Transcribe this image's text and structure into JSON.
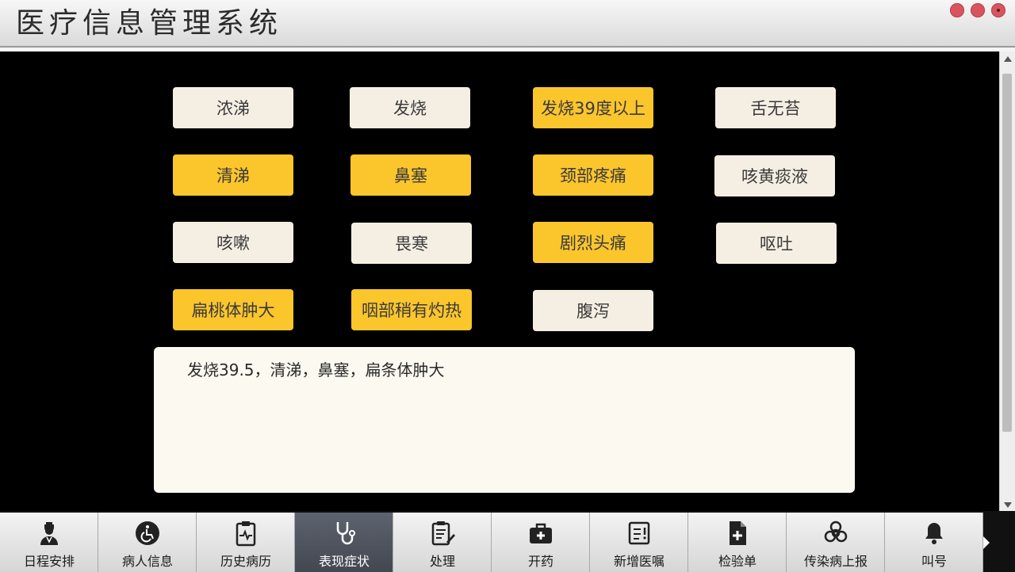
{
  "app": {
    "title": "医疗信息管理系统"
  },
  "symptoms": [
    {
      "label": "浓涕",
      "selected": false
    },
    {
      "label": "发烧",
      "selected": false
    },
    {
      "label": "发烧39度以上",
      "selected": true
    },
    {
      "label": "舌无苔",
      "selected": false
    },
    {
      "label": "清涕",
      "selected": true
    },
    {
      "label": "鼻塞",
      "selected": true
    },
    {
      "label": "颈部疼痛",
      "selected": true
    },
    {
      "label": "咳黄痰液",
      "selected": false
    },
    {
      "label": "咳嗽",
      "selected": false
    },
    {
      "label": "畏寒",
      "selected": false
    },
    {
      "label": "剧烈头痛",
      "selected": true
    },
    {
      "label": "呕吐",
      "selected": false
    },
    {
      "label": "扁桃体肿大",
      "selected": true
    },
    {
      "label": "咽部稍有灼热",
      "selected": true
    },
    {
      "label": "腹泻",
      "selected": false
    }
  ],
  "notes": {
    "text": "发烧39.5，清涕，鼻塞，扁条体肿大"
  },
  "nav": [
    {
      "label": "日程安排",
      "icon": "doctor-icon"
    },
    {
      "label": "病人信息",
      "icon": "wheelchair-icon"
    },
    {
      "label": "历史病历",
      "icon": "clipboard-pulse-icon"
    },
    {
      "label": "表现症状",
      "icon": "stethoscope-icon",
      "active": true
    },
    {
      "label": "处理",
      "icon": "edit-document-icon"
    },
    {
      "label": "开药",
      "icon": "medkit-icon"
    },
    {
      "label": "新增医嘱",
      "icon": "notes-alert-icon"
    },
    {
      "label": "检验单",
      "icon": "file-plus-icon"
    },
    {
      "label": "传染病上报",
      "icon": "biohazard-icon"
    },
    {
      "label": "叫号",
      "icon": "bell-icon"
    }
  ],
  "colors": {
    "selected": "#fbc52c",
    "unselected": "#f5efe3",
    "active_tab": "#4a4f58"
  }
}
